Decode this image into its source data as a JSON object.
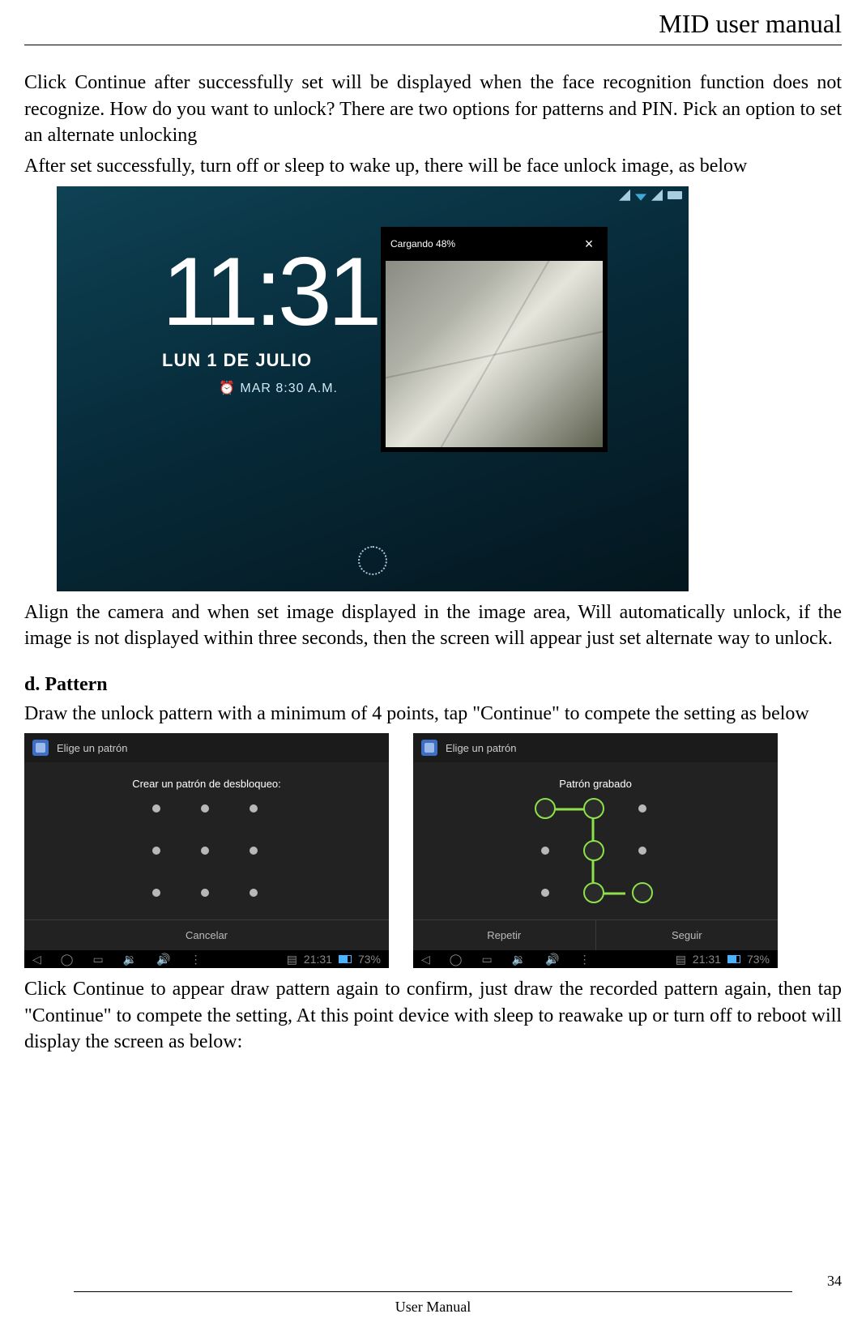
{
  "header": {
    "title": "MID user manual"
  },
  "body": {
    "p1": "Click Continue after successfully set will be displayed when the face recognition function does not recognize. How do you want to unlock? There are two options for patterns and PIN. Pick an option to set an alternate unlocking",
    "p2": "After set successfully, turn off or sleep to wake up, there will be face unlock image, as below",
    "p3": "Align the camera and when set image displayed in the image area, Will automatically unlock, if the image is not displayed within three seconds, then the screen will appear just set alternate way to unlock.",
    "d_title": "d. Pattern",
    "p4": "Draw the unlock pattern with a minimum of 4 points, tap \"Continue\" to compete the setting as below",
    "p5": "Click Continue to appear draw pattern again to confirm, just draw the recorded pattern again, then tap \"Continue\" to compete the setting, At this point device with sleep to reawake up or turn off to reboot will display the screen as below:"
  },
  "lockscreen": {
    "time_hour": "11",
    "time_min": ":31",
    "date": "LUN 1 DE JULIO",
    "alarm": "MAR 8:30 A.M.",
    "camera_status": "Cargando 48%",
    "close": "×"
  },
  "pattern_left": {
    "tab_title": "Elige un patrón",
    "subtitle": "Crear un patrón de desbloqueo:",
    "cancel": "Cancelar",
    "time": "21:31",
    "battery": "73%"
  },
  "pattern_right": {
    "tab_title": "Elige un patrón",
    "subtitle": "Patrón grabado",
    "repeat": "Repetir",
    "continue": "Seguir",
    "time": "21:31",
    "battery": "73%"
  },
  "footer": {
    "label": "User Manual",
    "page": "34"
  }
}
